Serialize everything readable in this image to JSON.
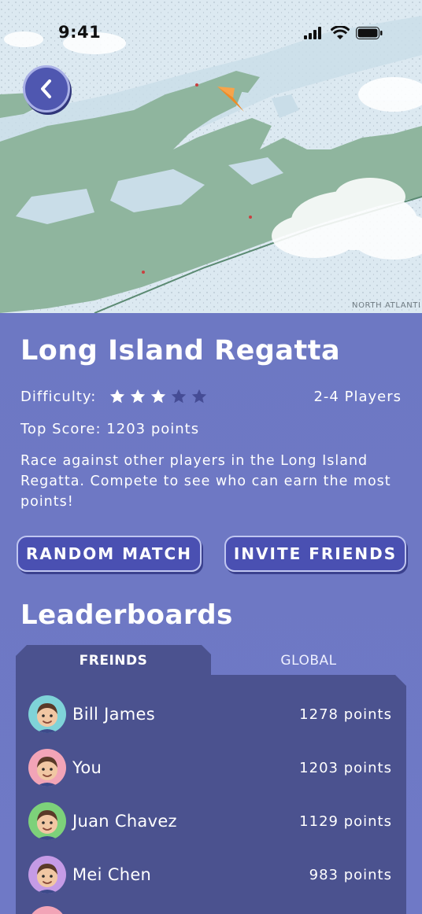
{
  "status_bar": {
    "time": "9:41"
  },
  "map": {
    "label_north_atlantic": "NORTH ATLANTI"
  },
  "game": {
    "title": "Long Island Regatta",
    "difficulty_label": "Difficulty:",
    "difficulty_rating": 3,
    "difficulty_max": 5,
    "players": "2-4 Players",
    "top_score": "Top Score: 1203 points",
    "description": "Race against other players in the Long Island Regatta. Compete to see who can earn the most points!"
  },
  "actions": {
    "random_match": "RANDOM MATCH",
    "invite_friends": "INVITE FRIENDS"
  },
  "leaderboards": {
    "heading": "Leaderboards",
    "tabs": [
      {
        "label": "FREINDS",
        "active": true
      },
      {
        "label": "GLOBAL",
        "active": false
      }
    ],
    "rows": [
      {
        "name": "Bill James",
        "points": "1278 points",
        "avatar_color": "#7fd3d8"
      },
      {
        "name": "You",
        "points": "1203 points",
        "avatar_color": "#f2a4b7"
      },
      {
        "name": "Juan Chavez",
        "points": "1129 points",
        "avatar_color": "#7dd17a"
      },
      {
        "name": "Mei Chen",
        "points": "983 points",
        "avatar_color": "#c59be6"
      },
      {
        "name": "",
        "points": "",
        "avatar_color": "#f2a4b7"
      }
    ]
  },
  "colors": {
    "background": "#6d78c3",
    "panel": "#4b528f",
    "button": "#4a50b2",
    "land": "#8fb59e",
    "water": "#dce9f1",
    "sail": "#f08a24"
  }
}
